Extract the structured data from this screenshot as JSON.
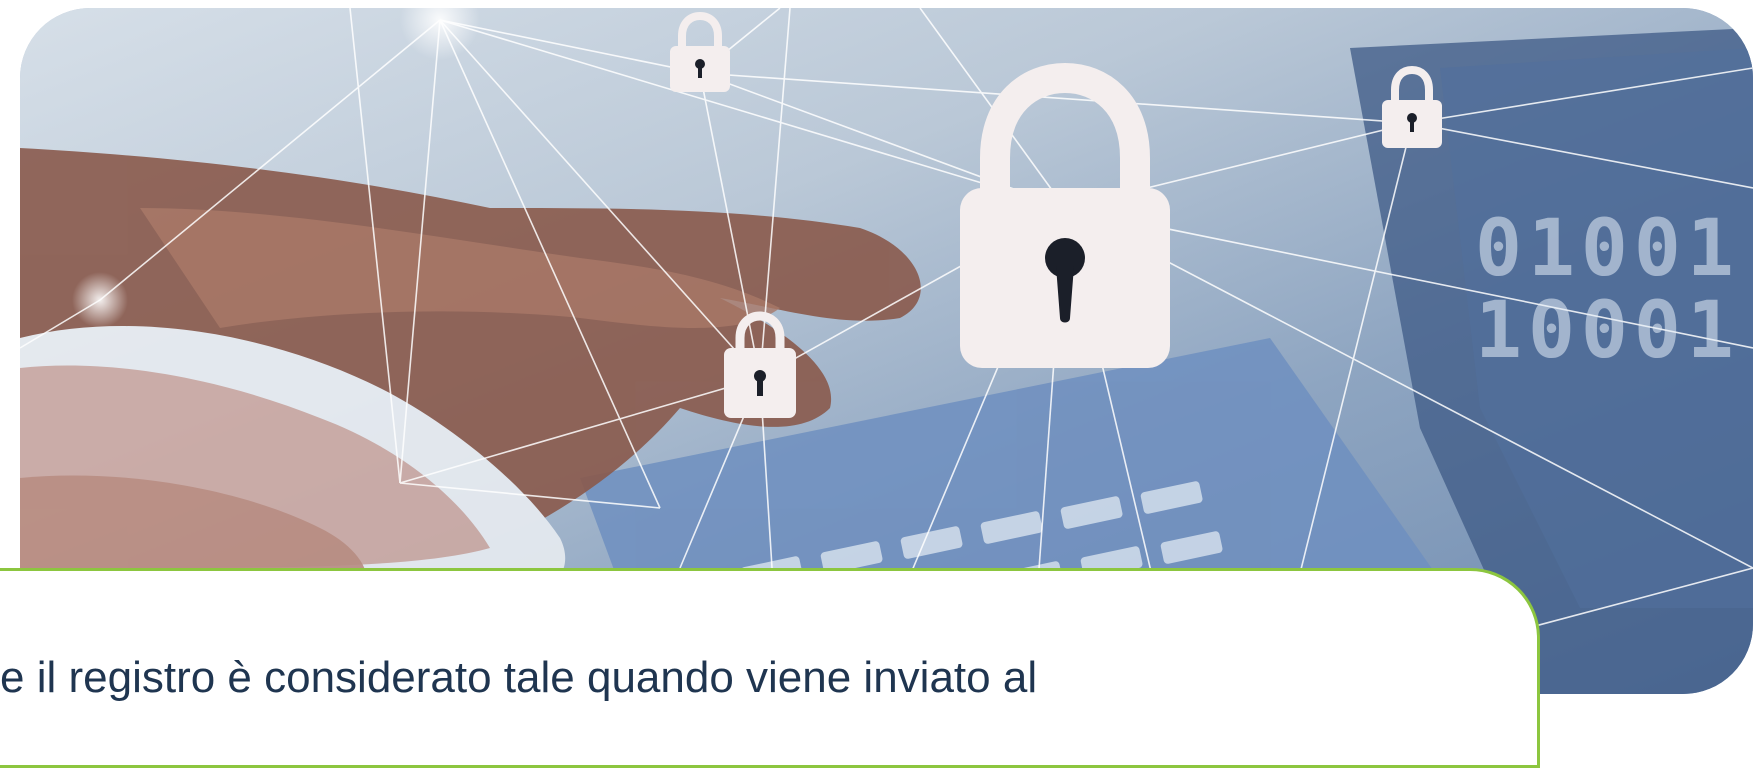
{
  "hero": {
    "binary_line_1": "01001",
    "binary_line_2": "10001",
    "icons": [
      "padlock-icon-large",
      "padlock-icon-small-top",
      "padlock-icon-small-right",
      "padlock-icon-small-center"
    ]
  },
  "caption": {
    "text": "e il registro è considerato tale quando viene inviato al"
  },
  "colors": {
    "accent_border": "#8cc63f",
    "caption_text": "#1f3550",
    "padlock": "#f4eeee",
    "keyhole": "#1b1f29"
  }
}
